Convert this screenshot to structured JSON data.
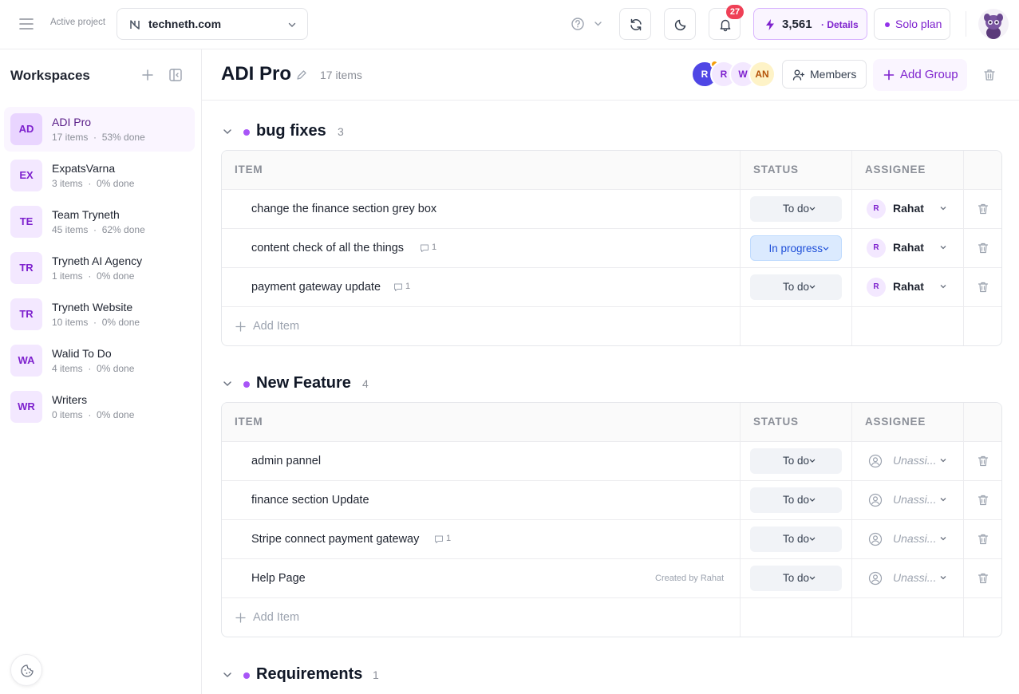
{
  "topbar": {
    "active_project_label": "Active project",
    "project_name": "techneth.com",
    "notification_count": "27",
    "credits": "3,561",
    "credits_details": "· Details",
    "plan_label": "Solo plan"
  },
  "sidebar": {
    "title": "Workspaces",
    "items": [
      {
        "initials": "AD",
        "name": "ADI Pro",
        "items": "17 items",
        "done": "53% done"
      },
      {
        "initials": "EX",
        "name": "ExpatsVarna",
        "items": "3 items",
        "done": "0% done"
      },
      {
        "initials": "TE",
        "name": "Team Tryneth",
        "items": "45 items",
        "done": "62% done"
      },
      {
        "initials": "TR",
        "name": "Tryneth AI Agency",
        "items": "1 items",
        "done": "0% done"
      },
      {
        "initials": "TR",
        "name": "Tryneth Website",
        "items": "10 items",
        "done": "0% done"
      },
      {
        "initials": "WA",
        "name": "Walid To Do",
        "items": "4 items",
        "done": "0% done"
      },
      {
        "initials": "WR",
        "name": "Writers",
        "items": "0 items",
        "done": "0% done"
      }
    ],
    "meta_separator": "·"
  },
  "main": {
    "title": "ADI Pro",
    "item_count": "17 items",
    "member_avatars": [
      {
        "initial": "R",
        "bg": "#4f46e5",
        "fg": "#ffffff"
      },
      {
        "initial": "R",
        "bg": "#f3e8ff",
        "fg": "#7e22ce"
      },
      {
        "initial": "W",
        "bg": "#f3e8ff",
        "fg": "#7e22ce"
      },
      {
        "initial": "AN",
        "bg": "#fef3c7",
        "fg": "#b45309"
      }
    ],
    "members_label": "Members",
    "add_group_label": "Add Group"
  },
  "table_headers": {
    "item": "ITEM",
    "status": "STATUS",
    "assignee": "ASSIGNEE"
  },
  "add_item_label": "Add Item",
  "groups": [
    {
      "name": "bug fixes",
      "count": "3",
      "items": [
        {
          "name": "change the finance section grey box",
          "comments": "",
          "created_by": "",
          "status": "To do",
          "assignee": "Rahat",
          "assignee_initial": "R"
        },
        {
          "name": "content check of all the things",
          "comments": "1",
          "created_by": "",
          "status": "In progress",
          "assignee": "Rahat",
          "assignee_initial": "R"
        },
        {
          "name": "payment gateway update",
          "comments": "1",
          "created_by": "",
          "status": "To do",
          "assignee": "Rahat",
          "assignee_initial": "R"
        }
      ]
    },
    {
      "name": "New Feature",
      "count": "4",
      "items": [
        {
          "name": "admin pannel",
          "comments": "",
          "created_by": "",
          "status": "To do",
          "assignee": "Unassi...",
          "assignee_initial": ""
        },
        {
          "name": "finance section Update",
          "comments": "",
          "created_by": "",
          "status": "To do",
          "assignee": "Unassi...",
          "assignee_initial": ""
        },
        {
          "name": "Stripe connect payment gateway",
          "comments": "1",
          "created_by": "",
          "status": "To do",
          "assignee": "Unassi...",
          "assignee_initial": ""
        },
        {
          "name": "Help Page",
          "comments": "",
          "created_by": "Created by Rahat",
          "status": "To do",
          "assignee": "Unassi...",
          "assignee_initial": ""
        }
      ]
    },
    {
      "name": "Requirements",
      "count": "1",
      "items": []
    }
  ],
  "colors": {
    "accent": "#7e22ce",
    "accent_light": "#faf5ff",
    "group_dot": "#a855f7",
    "notification": "#ef4056",
    "status_in_progress": "#dbeafe"
  }
}
